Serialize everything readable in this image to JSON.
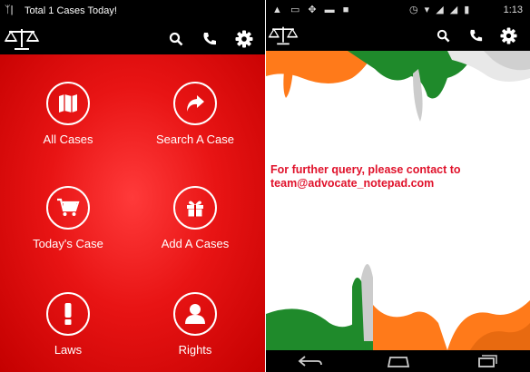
{
  "left_screen": {
    "status_text": "Total 1 Cases Today!",
    "menu": [
      {
        "label": "All Cases",
        "icon": "book-map-icon"
      },
      {
        "label": "Search A Case",
        "icon": "share-arrow-icon"
      },
      {
        "label": "Today's Case",
        "icon": "cart-icon"
      },
      {
        "label": "Add A Cases",
        "icon": "gift-icon"
      },
      {
        "label": "Laws",
        "icon": "exclamation-icon"
      },
      {
        "label": "Rights",
        "icon": "person-icon"
      }
    ]
  },
  "right_screen": {
    "time": "1:13",
    "contact_line1": "For further query, please contact to",
    "contact_line2": "team@advocate_notepad.com"
  },
  "colors": {
    "menu_red": "#e81414",
    "contact_text": "#e0122b",
    "flag_saffron": "#ff7a1a",
    "flag_green": "#1f8a2b"
  }
}
